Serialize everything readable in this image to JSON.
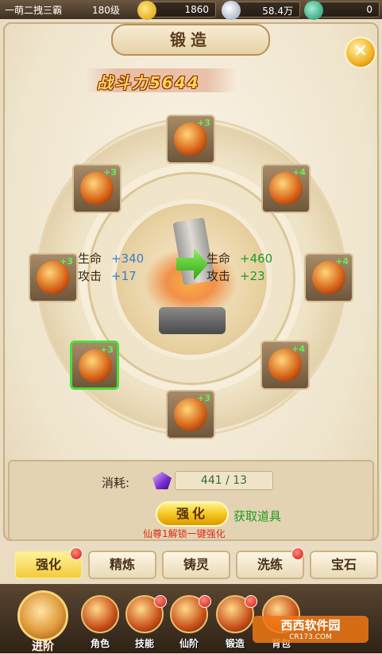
{
  "topbar": {
    "player_name": "一萌二拽三霸",
    "level": "180级",
    "gold": "1860",
    "silver": "58.4万",
    "jade": "0"
  },
  "panel": {
    "title": "锻造",
    "close_label": "✕",
    "power": "战斗力5644"
  },
  "stats": {
    "current": [
      {
        "name": "生命",
        "value": "+340"
      },
      {
        "name": "攻击",
        "value": "+17"
      }
    ],
    "next": [
      {
        "name": "生命",
        "value": "+460"
      },
      {
        "name": "攻击",
        "value": "+23"
      }
    ]
  },
  "equipment": [
    {
      "slot": "weapon",
      "level": "+3"
    },
    {
      "slot": "ring",
      "level": "+3"
    },
    {
      "slot": "helmet",
      "level": "+4"
    },
    {
      "slot": "shoulder",
      "level": "+3"
    },
    {
      "slot": "armor",
      "level": "+4"
    },
    {
      "slot": "boots",
      "level": "+3",
      "selected": true
    },
    {
      "slot": "necklace",
      "level": "+4"
    },
    {
      "slot": "belt",
      "level": "+3"
    }
  ],
  "cost": {
    "label": "消耗:",
    "amount": "441 / 13",
    "strengthen_label": "强化",
    "get_items_label": "获取道具",
    "unlock_tip": "仙尊1解锁一键强化"
  },
  "tabs": [
    {
      "label": "强化",
      "active": true,
      "badge": true
    },
    {
      "label": "精炼",
      "active": false,
      "badge": false
    },
    {
      "label": "铸灵",
      "active": false,
      "badge": false
    },
    {
      "label": "洗练",
      "active": false,
      "badge": true
    },
    {
      "label": "宝石",
      "active": false,
      "badge": false
    }
  ],
  "nav": {
    "advance": "进阶",
    "items": [
      "角色",
      "技能",
      "仙阶",
      "锻造",
      "背包"
    ]
  },
  "watermark": {
    "brand": "西西软件园",
    "url": "CR173.COM"
  },
  "colors": {
    "gold_accent": "#f3c31a",
    "green_stat": "#1e9a2c",
    "blue_stat": "#3a7bd0",
    "red_tip": "#e02a1a"
  }
}
